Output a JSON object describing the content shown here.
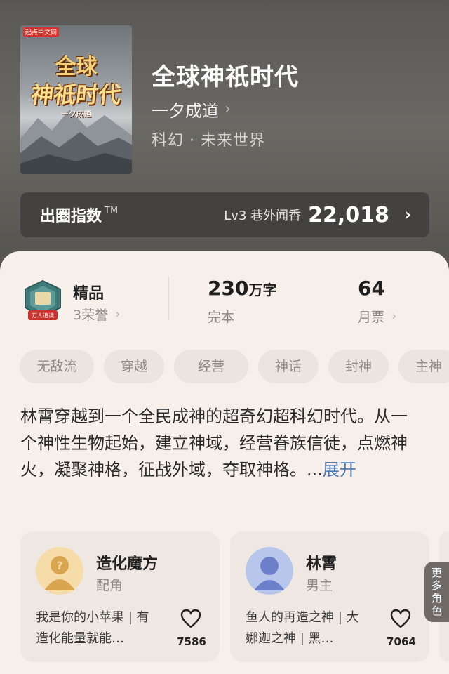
{
  "book": {
    "cover": {
      "publisher": "起点中文网",
      "title_line1": "全球",
      "title_line2": "神祇时代",
      "author_mark": "一夕成道"
    },
    "title": "全球神祇时代",
    "author": "一夕成道",
    "genre": "科幻 · 未来世界"
  },
  "index": {
    "label": "出圈指数",
    "tm": "TM",
    "level_text": "Lv3 巷外闻香",
    "value": "22,018"
  },
  "stats": {
    "quality": {
      "title": "精品",
      "honors": "3荣誉",
      "badge_text": "万人追读"
    },
    "words": {
      "value": "230",
      "unit": "万字",
      "status": "完本"
    },
    "tickets": {
      "value": "64",
      "label": "月票"
    }
  },
  "tags": [
    "无敌流",
    "穿越",
    "经营",
    "神话",
    "封神",
    "主神"
  ],
  "description": {
    "text": "林霄穿越到一个全民成神的超奇幻超科幻时代。从一个神性生物起始，建立神域，经营眷族信徒，点燃神火，凝聚神格，征战外域，夺取神格。...",
    "expand": "展开"
  },
  "roles": [
    {
      "name": "造化魔方",
      "type": "配角",
      "desc": "我是你的小苹果 | 有造化能量就能…",
      "likes": "7586",
      "avatar": "question-avatar"
    },
    {
      "name": "林霄",
      "type": "男主",
      "desc": "鱼人的再造之神 | 大娜迦之神 | 黑…",
      "likes": "7064",
      "avatar": "male-avatar"
    }
  ],
  "more_roles_label": "更多角色",
  "colors": {
    "hero_bg": "#5e5d59",
    "card_bg": "#f7f0ea",
    "link": "#4a79b8"
  }
}
